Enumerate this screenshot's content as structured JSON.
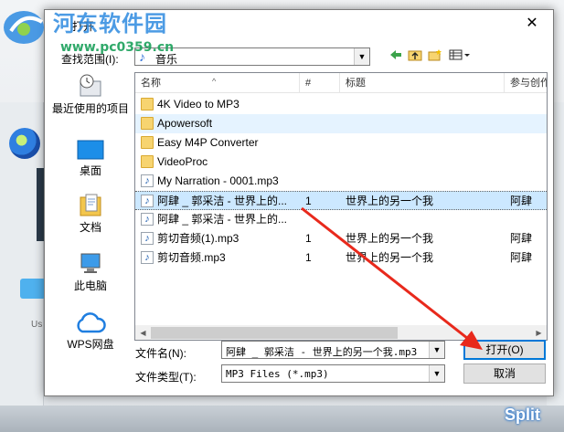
{
  "watermark": {
    "site_name": "河东软件园",
    "url": "www.pc0359.cn"
  },
  "background": {
    "split_label": "Split",
    "user_label": "Us"
  },
  "dialog": {
    "title": "打开",
    "close_glyph": "✕",
    "look_in_label": "查找范围(I):",
    "look_in_value": "音乐",
    "places": [
      {
        "label": "最近使用的项目",
        "icon": "recent-places-icon"
      },
      {
        "label": "桌面",
        "icon": "desktop-icon"
      },
      {
        "label": "文档",
        "icon": "documents-icon"
      },
      {
        "label": "此电脑",
        "icon": "this-pc-icon"
      },
      {
        "label": "WPS网盘",
        "icon": "wps-cloud-icon"
      }
    ],
    "columns": [
      "名称",
      "#",
      "标题",
      "参与创作"
    ],
    "files": [
      {
        "name": "4K Video to MP3",
        "type": "folder",
        "num": "",
        "title": "",
        "artist": ""
      },
      {
        "name": "Apowersoft",
        "type": "folder",
        "num": "",
        "title": "",
        "artist": ""
      },
      {
        "name": "Easy M4P Converter",
        "type": "folder",
        "num": "",
        "title": "",
        "artist": ""
      },
      {
        "name": "VideoProc",
        "type": "folder",
        "num": "",
        "title": "",
        "artist": ""
      },
      {
        "name": "My Narration - 0001.mp3",
        "type": "audio",
        "num": "",
        "title": "",
        "artist": ""
      },
      {
        "name": "阿肆 _ 郭采洁 - 世界上的...",
        "type": "audio",
        "num": "1",
        "title": "世界上的另一个我",
        "artist": "阿肆"
      },
      {
        "name": "阿肆 _ 郭采洁 - 世界上的...",
        "type": "audio",
        "num": "",
        "title": "",
        "artist": ""
      },
      {
        "name": "剪切音频(1).mp3",
        "type": "audio",
        "num": "1",
        "title": "世界上的另一个我",
        "artist": "阿肆"
      },
      {
        "name": "剪切音频.mp3",
        "type": "audio",
        "num": "1",
        "title": "世界上的另一个我",
        "artist": "阿肆"
      }
    ],
    "selected_index": 5,
    "hover_index": 1,
    "filename_label": "文件名(N):",
    "filename_value": "阿肆 _ 郭采洁 - 世界上的另一个我.mp3",
    "filetype_label": "文件类型(T):",
    "filetype_value": "MP3 Files (*.mp3)",
    "open_button": "打开(O)",
    "cancel_button": "取消"
  },
  "colors": {
    "selection": "#cce8ff",
    "hover": "#e5f3ff",
    "arrow": "#e8291c",
    "accent": "#0078d7"
  }
}
